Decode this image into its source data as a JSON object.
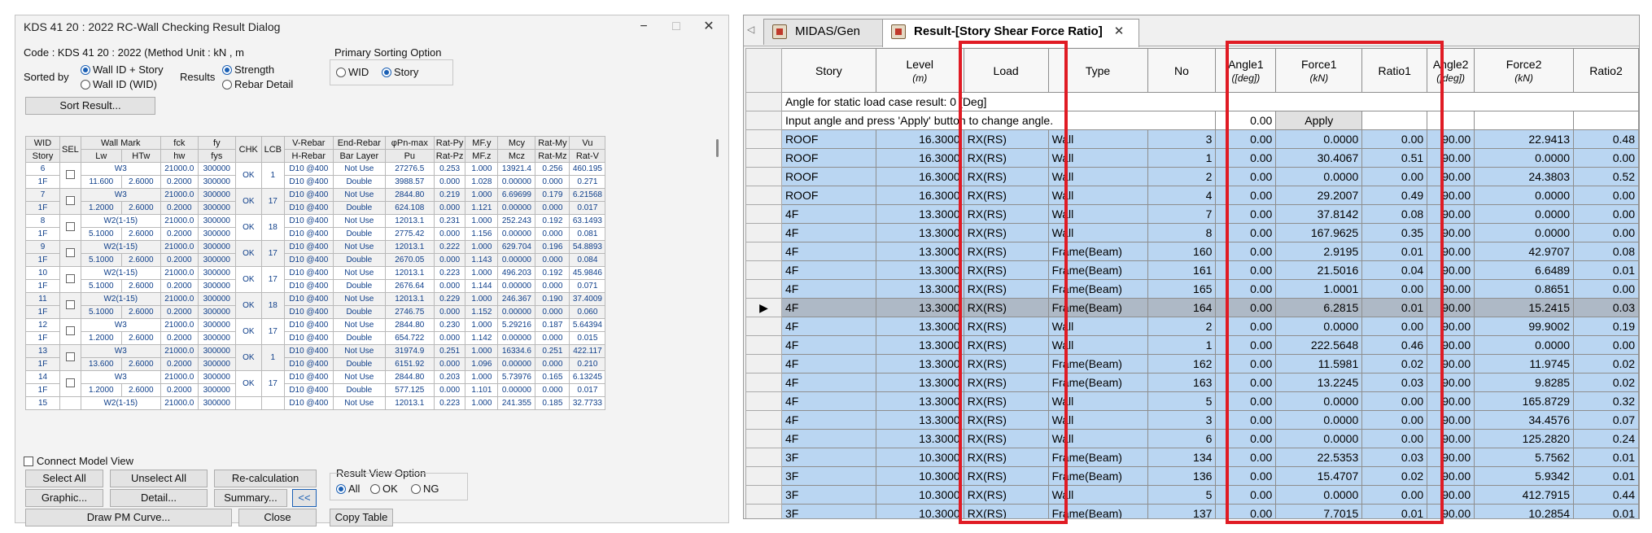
{
  "dialog": {
    "title": "KDS 41 20 : 2022 RC-Wall Checking Result Dialog",
    "min": "−",
    "max": "□",
    "close": "✕",
    "code_text": "Code : KDS 41 20 : 2022 (Method   Unit :  kN    ,    m",
    "sorted_by": "Sorted by",
    "sort_opt1": "Wall ID + Story",
    "sort_opt2": "Wall ID (WID)",
    "results": "Results",
    "res_opt1": "Strength",
    "res_opt2": "Rebar Detail",
    "primary_title": "Primary Sorting Option",
    "prim_opt1": "WID",
    "prim_opt2": "Story",
    "sort_btn": "Sort Result...",
    "headers1": [
      "WID",
      "SEL",
      "Wall Mark",
      "fck",
      "fy",
      "CHK",
      "LCB",
      "V-Rebar",
      "End-Rebar",
      "φPn-max",
      "Rat-Py",
      "MF.y",
      "Mcy",
      "Rat-My",
      "Vu"
    ],
    "headers2": [
      "Story",
      "Lw",
      "HTw",
      "hw",
      "fys",
      "H-Rebar",
      "Bar Layer",
      "Pu",
      "Rat-Pz",
      "MF.z",
      "Mcz",
      "Rat-Mz",
      "Rat-V"
    ],
    "rows": [
      {
        "wid": "6",
        "mark": "W3",
        "fck": "21000.0",
        "fy": "300000",
        "chk": "OK",
        "lcb": "1",
        "vr": "D10 @400",
        "er": "Not Use",
        "pn": "27276.5",
        "rpy": "0.253",
        "mfy": "1.000",
        "mcy": "13921.4",
        "rmy": "0.256",
        "vu": "460.195",
        "story": "1F",
        "lw": "11.600",
        "htw": "2.6000",
        "hw": "0.2000",
        "fys": "300000",
        "hr": "D10 @400",
        "bl": "Double",
        "pu": "3988.57",
        "rpz": "0.000",
        "mfz": "1.028",
        "mcz": "0.00000",
        "rmz": "0.000",
        "rv": "0.271"
      },
      {
        "wid": "7",
        "mark": "W3",
        "fck": "21000.0",
        "fy": "300000",
        "chk": "OK",
        "lcb": "17",
        "vr": "D10 @400",
        "er": "Not Use",
        "pn": "2844.80",
        "rpy": "0.219",
        "mfy": "1.000",
        "mcy": "6.69699",
        "rmy": "0.179",
        "vu": "6.21568",
        "story": "1F",
        "lw": "1.2000",
        "htw": "2.6000",
        "hw": "0.2000",
        "fys": "300000",
        "hr": "D10 @400",
        "bl": "Double",
        "pu": "624.108",
        "rpz": "0.000",
        "mfz": "1.121",
        "mcz": "0.00000",
        "rmz": "0.000",
        "rv": "0.017"
      },
      {
        "wid": "8",
        "mark": "W2(1-15)",
        "fck": "21000.0",
        "fy": "300000",
        "chk": "OK",
        "lcb": "18",
        "vr": "D10 @400",
        "er": "Not Use",
        "pn": "12013.1",
        "rpy": "0.231",
        "mfy": "1.000",
        "mcy": "252.243",
        "rmy": "0.192",
        "vu": "63.1493",
        "story": "1F",
        "lw": "5.1000",
        "htw": "2.6000",
        "hw": "0.2000",
        "fys": "300000",
        "hr": "D10 @400",
        "bl": "Double",
        "pu": "2775.42",
        "rpz": "0.000",
        "mfz": "1.156",
        "mcz": "0.00000",
        "rmz": "0.000",
        "rv": "0.081"
      },
      {
        "wid": "9",
        "mark": "W2(1-15)",
        "fck": "21000.0",
        "fy": "300000",
        "chk": "OK",
        "lcb": "17",
        "vr": "D10 @400",
        "er": "Not Use",
        "pn": "12013.1",
        "rpy": "0.222",
        "mfy": "1.000",
        "mcy": "629.704",
        "rmy": "0.196",
        "vu": "54.8893",
        "story": "1F",
        "lw": "5.1000",
        "htw": "2.6000",
        "hw": "0.2000",
        "fys": "300000",
        "hr": "D10 @400",
        "bl": "Double",
        "pu": "2670.05",
        "rpz": "0.000",
        "mfz": "1.143",
        "mcz": "0.00000",
        "rmz": "0.000",
        "rv": "0.084"
      },
      {
        "wid": "10",
        "mark": "W2(1-15)",
        "fck": "21000.0",
        "fy": "300000",
        "chk": "OK",
        "lcb": "17",
        "vr": "D10 @400",
        "er": "Not Use",
        "pn": "12013.1",
        "rpy": "0.223",
        "mfy": "1.000",
        "mcy": "496.203",
        "rmy": "0.192",
        "vu": "45.9846",
        "story": "1F",
        "lw": "5.1000",
        "htw": "2.6000",
        "hw": "0.2000",
        "fys": "300000",
        "hr": "D10 @400",
        "bl": "Double",
        "pu": "2676.64",
        "rpz": "0.000",
        "mfz": "1.144",
        "mcz": "0.00000",
        "rmz": "0.000",
        "rv": "0.071"
      },
      {
        "wid": "11",
        "mark": "W2(1-15)",
        "fck": "21000.0",
        "fy": "300000",
        "chk": "OK",
        "lcb": "18",
        "vr": "D10 @400",
        "er": "Not Use",
        "pn": "12013.1",
        "rpy": "0.229",
        "mfy": "1.000",
        "mcy": "246.367",
        "rmy": "0.190",
        "vu": "37.4009",
        "story": "1F",
        "lw": "5.1000",
        "htw": "2.6000",
        "hw": "0.2000",
        "fys": "300000",
        "hr": "D10 @400",
        "bl": "Double",
        "pu": "2746.75",
        "rpz": "0.000",
        "mfz": "1.152",
        "mcz": "0.00000",
        "rmz": "0.000",
        "rv": "0.060"
      },
      {
        "wid": "12",
        "mark": "W3",
        "fck": "21000.0",
        "fy": "300000",
        "chk": "OK",
        "lcb": "17",
        "vr": "D10 @400",
        "er": "Not Use",
        "pn": "2844.80",
        "rpy": "0.230",
        "mfy": "1.000",
        "mcy": "5.29216",
        "rmy": "0.187",
        "vu": "5.64394",
        "story": "1F",
        "lw": "1.2000",
        "htw": "2.6000",
        "hw": "0.2000",
        "fys": "300000",
        "hr": "D10 @400",
        "bl": "Double",
        "pu": "654.722",
        "rpz": "0.000",
        "mfz": "1.142",
        "mcz": "0.00000",
        "rmz": "0.000",
        "rv": "0.015"
      },
      {
        "wid": "13",
        "mark": "W3",
        "fck": "21000.0",
        "fy": "300000",
        "chk": "OK",
        "lcb": "1",
        "vr": "D10 @400",
        "er": "Not Use",
        "pn": "31974.9",
        "rpy": "0.251",
        "mfy": "1.000",
        "mcy": "16334.6",
        "rmy": "0.251",
        "vu": "422.117",
        "story": "1F",
        "lw": "13.600",
        "htw": "2.6000",
        "hw": "0.2000",
        "fys": "300000",
        "hr": "D10 @400",
        "bl": "Double",
        "pu": "6151.92",
        "rpz": "0.000",
        "mfz": "1.096",
        "mcz": "0.00000",
        "rmz": "0.000",
        "rv": "0.210"
      },
      {
        "wid": "14",
        "mark": "W3",
        "fck": "21000.0",
        "fy": "300000",
        "chk": "OK",
        "lcb": "17",
        "vr": "D10 @400",
        "er": "Not Use",
        "pn": "2844.80",
        "rpy": "0.203",
        "mfy": "1.000",
        "mcy": "5.73976",
        "rmy": "0.165",
        "vu": "6.13245",
        "story": "1F",
        "lw": "1.2000",
        "htw": "2.6000",
        "hw": "0.2000",
        "fys": "300000",
        "hr": "D10 @400",
        "bl": "Double",
        "pu": "577.125",
        "rpz": "0.000",
        "mfz": "1.101",
        "mcz": "0.00000",
        "rmz": "0.000",
        "rv": "0.017"
      }
    ],
    "partial": {
      "wid": "15",
      "mark": "W2(1-15)",
      "fck": "21000.0",
      "fy": "300000",
      "vr": "D10 @400",
      "er": "Not Use",
      "pn": "12013.1",
      "rpy": "0.223",
      "mfy": "1.000",
      "mcy": "241.355",
      "rmy": "0.185",
      "vu": "32.7733"
    },
    "connect_model": "Connect Model View",
    "btn_select_all": "Select All",
    "btn_unselect_all": "Unselect All",
    "btn_recalc": "Re-calculation",
    "btn_graphic": "Graphic...",
    "btn_detail": "Detail...",
    "btn_summary": "Summary...",
    "btn_collapse": "<<",
    "btn_pm": "Draw PM Curve...",
    "btn_close": "Close",
    "view_title": "Result View Option",
    "view_all": "All",
    "view_ok": "OK",
    "view_ng": "NG",
    "btn_copy": "Copy Table"
  },
  "result": {
    "tab_arrow": "◁",
    "tab1": "MIDAS/Gen",
    "tab2": "Result-[Story Shear Force Ratio]",
    "tab_close": "✕",
    "headers": [
      "Story",
      "Level",
      "Load",
      "Type",
      "No",
      "Angle1",
      "Force1",
      "Ratio1",
      "Angle2",
      "Force2",
      "Ratio2"
    ],
    "units": [
      "",
      "(m)",
      "",
      "",
      "",
      "([deg])",
      "(kN)",
      "",
      "([deg])",
      "(kN)",
      ""
    ],
    "info1": "Angle for static load case result: 0 [Deg]",
    "info2": "Input angle and press 'Apply' button to change angle.",
    "angle_input": "0.00",
    "apply": "Apply",
    "rows": [
      [
        "ROOF",
        "16.3000",
        "RX(RS)",
        "Wall",
        "3",
        "0.00",
        "0.0000",
        "0.00",
        "90.00",
        "22.9413",
        "0.48"
      ],
      [
        "ROOF",
        "16.3000",
        "RX(RS)",
        "Wall",
        "1",
        "0.00",
        "30.4067",
        "0.51",
        "90.00",
        "0.0000",
        "0.00"
      ],
      [
        "ROOF",
        "16.3000",
        "RX(RS)",
        "Wall",
        "2",
        "0.00",
        "0.0000",
        "0.00",
        "90.00",
        "24.3803",
        "0.52"
      ],
      [
        "ROOF",
        "16.3000",
        "RX(RS)",
        "Wall",
        "4",
        "0.00",
        "29.2007",
        "0.49",
        "90.00",
        "0.0000",
        "0.00"
      ],
      [
        "4F",
        "13.3000",
        "RX(RS)",
        "Wall",
        "7",
        "0.00",
        "37.8142",
        "0.08",
        "90.00",
        "0.0000",
        "0.00"
      ],
      [
        "4F",
        "13.3000",
        "RX(RS)",
        "Wall",
        "8",
        "0.00",
        "167.9625",
        "0.35",
        "90.00",
        "0.0000",
        "0.00"
      ],
      [
        "4F",
        "13.3000",
        "RX(RS)",
        "Frame(Beam)",
        "160",
        "0.00",
        "2.9195",
        "0.01",
        "90.00",
        "42.9707",
        "0.08"
      ],
      [
        "4F",
        "13.3000",
        "RX(RS)",
        "Frame(Beam)",
        "161",
        "0.00",
        "21.5016",
        "0.04",
        "90.00",
        "6.6489",
        "0.01"
      ],
      [
        "4F",
        "13.3000",
        "RX(RS)",
        "Frame(Beam)",
        "165",
        "0.00",
        "1.0001",
        "0.00",
        "90.00",
        "0.8651",
        "0.00"
      ],
      [
        "4F",
        "13.3000",
        "RX(RS)",
        "Frame(Beam)",
        "164",
        "0.00",
        "6.2815",
        "0.01",
        "90.00",
        "15.2415",
        "0.03"
      ],
      [
        "4F",
        "13.3000",
        "RX(RS)",
        "Wall",
        "2",
        "0.00",
        "0.0000",
        "0.00",
        "90.00",
        "99.9002",
        "0.19"
      ],
      [
        "4F",
        "13.3000",
        "RX(RS)",
        "Wall",
        "1",
        "0.00",
        "222.5648",
        "0.46",
        "90.00",
        "0.0000",
        "0.00"
      ],
      [
        "4F",
        "13.3000",
        "RX(RS)",
        "Frame(Beam)",
        "162",
        "0.00",
        "11.5981",
        "0.02",
        "90.00",
        "11.9745",
        "0.02"
      ],
      [
        "4F",
        "13.3000",
        "RX(RS)",
        "Frame(Beam)",
        "163",
        "0.00",
        "13.2245",
        "0.03",
        "90.00",
        "9.8285",
        "0.02"
      ],
      [
        "4F",
        "13.3000",
        "RX(RS)",
        "Wall",
        "5",
        "0.00",
        "0.0000",
        "0.00",
        "90.00",
        "165.8729",
        "0.32"
      ],
      [
        "4F",
        "13.3000",
        "RX(RS)",
        "Wall",
        "3",
        "0.00",
        "0.0000",
        "0.00",
        "90.00",
        "34.4576",
        "0.07"
      ],
      [
        "4F",
        "13.3000",
        "RX(RS)",
        "Wall",
        "6",
        "0.00",
        "0.0000",
        "0.00",
        "90.00",
        "125.2820",
        "0.24"
      ],
      [
        "3F",
        "10.3000",
        "RX(RS)",
        "Frame(Beam)",
        "134",
        "0.00",
        "22.5353",
        "0.03",
        "90.00",
        "5.7562",
        "0.01"
      ],
      [
        "3F",
        "10.3000",
        "RX(RS)",
        "Frame(Beam)",
        "136",
        "0.00",
        "15.4707",
        "0.02",
        "90.00",
        "5.9342",
        "0.01"
      ],
      [
        "3F",
        "10.3000",
        "RX(RS)",
        "Wall",
        "5",
        "0.00",
        "0.0000",
        "0.00",
        "90.00",
        "412.7915",
        "0.44"
      ],
      [
        "3F",
        "10.3000",
        "RX(RS)",
        "Frame(Beam)",
        "137",
        "0.00",
        "7.7015",
        "0.01",
        "90.00",
        "10.2854",
        "0.01"
      ]
    ],
    "selected_index": 9,
    "row_pointer": "▶"
  }
}
